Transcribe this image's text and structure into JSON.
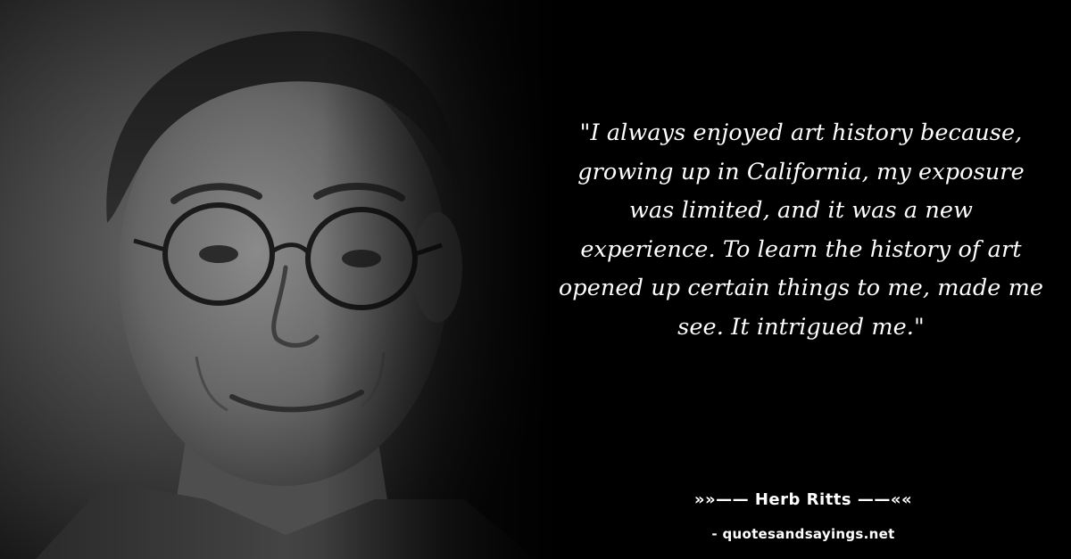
{
  "quote": {
    "lines": [
      "\"I always enjoyed art history because,",
      "growing up in California, my exposure",
      "was limited, and it was a new",
      "experience. To learn the history of art",
      "opened up certain things to me, made me",
      "see. It intrigued me.\""
    ]
  },
  "attribution": {
    "author_line": "»»—— Herb Ritts ——««"
  },
  "footer": {
    "source": "- quotesandsayings.net"
  },
  "colors": {
    "background": "#000000",
    "text": "#ffffff"
  }
}
